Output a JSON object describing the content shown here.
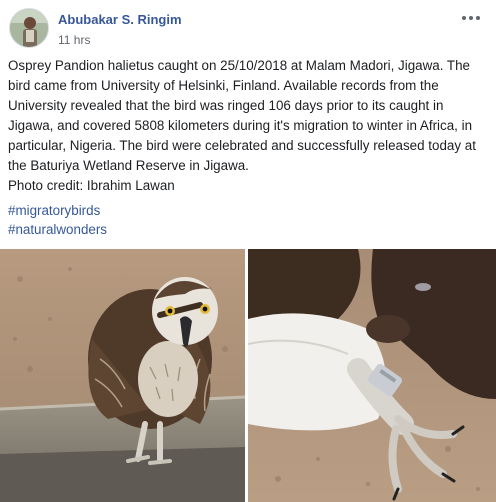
{
  "post": {
    "author": "Abubakar S. Ringim",
    "timestamp": "11 hrs",
    "more_icon": "ellipsis-icon",
    "text": "Osprey Pandion halietus caught on 25/10/2018 at Malam Madori, Jigawa. The bird came from University of Helsinki, Finland. Available records from the University revealed that the bird was ringed 106 days prior to its caught in Jigawa, and covered 5808 kilometers during it's migration to winter in Africa, in particular, Nigeria. The bird were celebrated and successfully released today at the Baturiya Wetland Reserve in Jigawa.",
    "photo_credit": "Photo credit: Ibrahim Lawan",
    "hashtags": [
      "#migratorybirds",
      "#naturalwonders"
    ]
  },
  "colors": {
    "link": "#365899",
    "text": "#1c1e21",
    "muted": "#616770"
  }
}
